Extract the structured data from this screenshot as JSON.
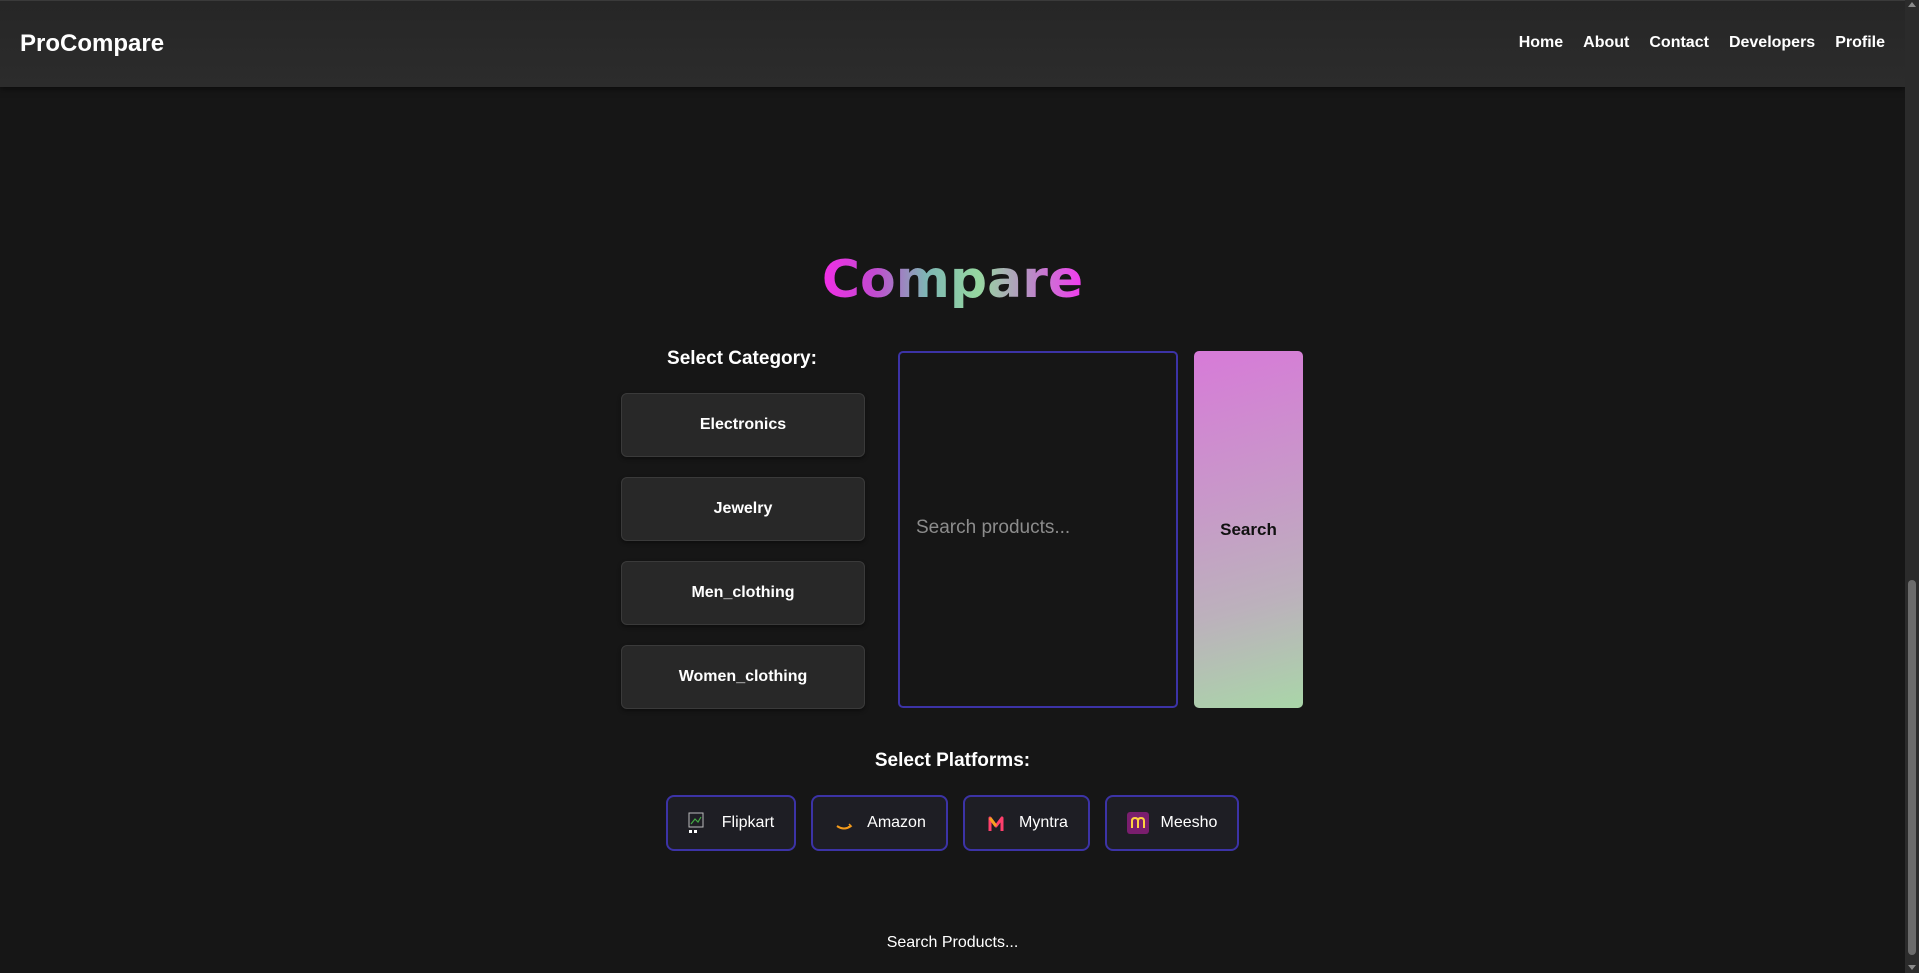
{
  "header": {
    "brand": "ProCompare",
    "nav": [
      "Home",
      "About",
      "Contact",
      "Developers",
      "Profile"
    ]
  },
  "main": {
    "title": "Compare",
    "category_label": "Select Category:",
    "categories": [
      "Electronics",
      "Jewelry",
      "Men_clothing",
      "Women_clothing"
    ],
    "search": {
      "placeholder": "Search products...",
      "value": ""
    },
    "search_button": "Search",
    "platforms_label": "Select Platforms:",
    "platforms": [
      {
        "label": "Flipkart",
        "icon": "flipkart-logo-icon"
      },
      {
        "label": "Amazon",
        "icon": "amazon-logo-icon"
      },
      {
        "label": "Myntra",
        "icon": "myntra-logo-icon"
      },
      {
        "label": "Meesho",
        "icon": "meesho-logo-icon"
      }
    ],
    "status_text": "Search Products..."
  },
  "colors": {
    "background": "#161616",
    "accent_border": "#3c33a6",
    "search_gradient_top": "#d77ad8",
    "search_gradient_bottom": "#a9d6a8"
  }
}
